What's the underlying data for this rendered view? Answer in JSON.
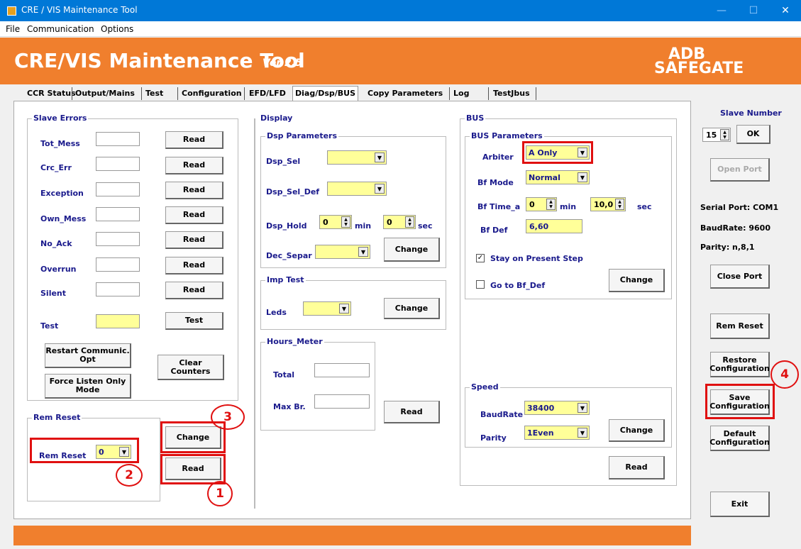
{
  "window": {
    "title": "CRE / VIS Maintenance Tool",
    "min": "—",
    "max": "☐",
    "close": "✕"
  },
  "menu": [
    "File",
    "Communication",
    "Options"
  ],
  "banner": {
    "title": "CRE/VIS Maintenance Tool",
    "version": "Ver 2.5",
    "logo_line1": "ADB",
    "logo_line2": "SAFEGATE"
  },
  "tabs": [
    "CCR Status",
    "Output/Mains",
    "Test",
    "Configuration",
    "EFD/LFD",
    "Diag/Dsp/BUS",
    "Copy Parameters",
    "Log",
    "TestJbus"
  ],
  "slave_errors": {
    "title": "Slave Errors",
    "rows": [
      {
        "label": "Tot_Mess",
        "btn": "Read"
      },
      {
        "label": "Crc_Err",
        "btn": "Read"
      },
      {
        "label": "Exception",
        "btn": "Read"
      },
      {
        "label": "Own_Mess",
        "btn": "Read"
      },
      {
        "label": "No_Ack",
        "btn": "Read"
      },
      {
        "label": "Overrun",
        "btn": "Read"
      },
      {
        "label": "Silent",
        "btn": "Read"
      },
      {
        "label": "Test",
        "btn": "Test"
      }
    ],
    "restart": "Restart Communic. Opt",
    "force": "Force Listen Only Mode",
    "clear": "Clear Counters"
  },
  "rem_reset": {
    "title": "Rem Reset",
    "label": "Rem Reset",
    "value": "0",
    "change": "Change",
    "read": "Read"
  },
  "display": {
    "title": "Display",
    "dsp_params": "Dsp Parameters",
    "dsp_sel": "Dsp_Sel",
    "dsp_sel_def": "Dsp_Sel_Def",
    "dsp_hold": "Dsp_Hold",
    "hold_min": "0",
    "min": "min",
    "hold_sec": "0",
    "sec": "sec",
    "dec_separ": "Dec_Separ",
    "change": "Change",
    "imp_test": "Imp Test",
    "leds": "Leds",
    "imp_change": "Change",
    "hours_meter": "Hours_Meter",
    "total": "Total",
    "max_br": "Max Br.",
    "read": "Read"
  },
  "bus": {
    "title": "BUS",
    "params": "BUS Parameters",
    "arbiter": "Arbiter",
    "arbiter_val": "A Only",
    "bf_mode": "Bf Mode",
    "bf_mode_val": "Normal",
    "bf_time": "Bf Time_a",
    "bf_time_min": "0",
    "min": "min",
    "bf_time_sec": "10,0",
    "sec": "sec",
    "bf_def": "Bf Def",
    "bf_def_val": "6,60",
    "stay": "Stay on Present Step",
    "goto": "Go to Bf_Def",
    "change": "Change",
    "speed": "Speed",
    "baud": "BaudRate",
    "baud_val": "38400",
    "parity": "Parity",
    "parity_val": "1Even",
    "speed_change": "Change",
    "read": "Read"
  },
  "right": {
    "slave_number": "Slave Number",
    "slave_val": "15",
    "ok": "OK",
    "open_port": "Open Port",
    "serial": "Serial Port: COM1",
    "baud": "BaudRate: 9600",
    "parity": "Parity: n,8,1",
    "close_port": "Close Port",
    "rem_reset": "Rem Reset",
    "restore": "Restore Configuration",
    "save": "Save Configuration",
    "default": "Default Configuration",
    "exit": "Exit"
  },
  "annotations": [
    "1",
    "2",
    "3",
    "4"
  ],
  "colors": {
    "accent": "#f07f2d",
    "title_bar": "#0078d7",
    "highlight": "#e01010",
    "field_yellow": "#ffff99"
  }
}
